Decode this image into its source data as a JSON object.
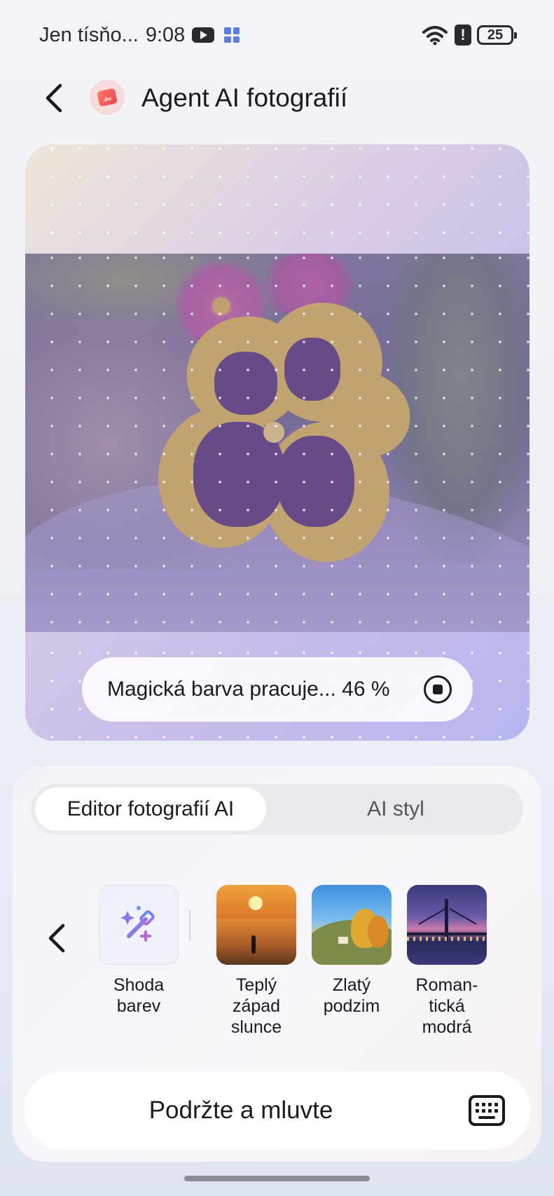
{
  "status_bar": {
    "carrier": "Jen tísňo...",
    "time": "9:08",
    "battery": "25",
    "icons": [
      "youtube-icon",
      "apps-icon",
      "wifi-icon",
      "alert-icon",
      "battery-icon"
    ]
  },
  "header": {
    "back_icon": "chevron-left-icon",
    "app_icon": "photos-app-icon",
    "title": "Agent AI fotografií"
  },
  "processing": {
    "status_text": "Magická barva pracuje... 46 %",
    "progress_percent": 46,
    "stop_icon": "stop-icon"
  },
  "tabs": [
    {
      "label": "Editor fotografií AI",
      "active": true
    },
    {
      "label": "AI styl",
      "active": false
    }
  ],
  "styles": {
    "back_icon": "chevron-left-icon",
    "items": [
      {
        "label": "Shoda barev",
        "icon": "magic-wand-icon"
      },
      {
        "label": "Teplý západ slunce",
        "icon": "sunset-thumbnail"
      },
      {
        "label": "Zlatý podzim",
        "icon": "autumn-thumbnail"
      },
      {
        "label": "Roman-tická modrá",
        "icon": "bridge-thumbnail"
      }
    ]
  },
  "voice": {
    "label": "Podržte a mluvte",
    "keyboard_icon": "keyboard-icon"
  },
  "colors": {
    "card_gradient_start": "#efe6d8",
    "card_gradient_end": "#b7b6f0",
    "panel_bg": "#f4f4f8",
    "text": "#1b1b1f"
  }
}
